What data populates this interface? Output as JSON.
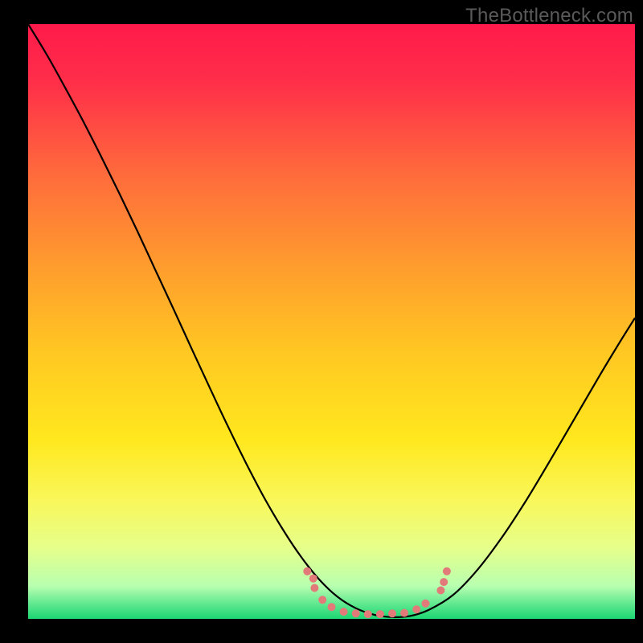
{
  "watermark": "TheBottleneck.com",
  "chart_data": {
    "type": "line",
    "title": "",
    "xlabel": "",
    "ylabel": "",
    "xlim": [
      0,
      100
    ],
    "ylim": [
      0,
      100
    ],
    "background_gradient": {
      "stops": [
        {
          "pos": 0.0,
          "color": "#ff1a4b"
        },
        {
          "pos": 0.1,
          "color": "#ff2f49"
        },
        {
          "pos": 0.25,
          "color": "#ff6a3c"
        },
        {
          "pos": 0.4,
          "color": "#ff9a2e"
        },
        {
          "pos": 0.55,
          "color": "#ffc722"
        },
        {
          "pos": 0.7,
          "color": "#ffe81e"
        },
        {
          "pos": 0.8,
          "color": "#f9f75a"
        },
        {
          "pos": 0.88,
          "color": "#e6ff8a"
        },
        {
          "pos": 0.945,
          "color": "#b8ffb0"
        },
        {
          "pos": 0.975,
          "color": "#5fe88f"
        },
        {
          "pos": 1.0,
          "color": "#1cd672"
        }
      ]
    },
    "series": [
      {
        "name": "bottleneck-curve",
        "color": "#000000",
        "x": [
          0.0,
          3.0,
          6.0,
          9.0,
          12.0,
          15.0,
          18.0,
          21.0,
          24.0,
          27.0,
          30.0,
          33.0,
          36.0,
          39.0,
          42.0,
          45.0,
          48.0,
          51.0,
          54.0,
          57.0,
          60.0,
          63.0,
          66.0,
          70.0,
          74.0,
          78.0,
          82.0,
          86.0,
          90.0,
          94.0,
          97.0,
          100.0
        ],
        "values": [
          100.0,
          95.0,
          89.5,
          83.8,
          77.8,
          71.6,
          65.2,
          58.6,
          52.0,
          45.3,
          38.7,
          32.2,
          26.0,
          20.2,
          15.0,
          10.4,
          6.6,
          3.7,
          1.8,
          0.7,
          0.3,
          0.5,
          1.5,
          4.0,
          8.2,
          13.6,
          19.8,
          26.6,
          33.6,
          40.6,
          45.7,
          50.6
        ]
      }
    ],
    "markers": [
      {
        "x": 46.0,
        "y": 8.0,
        "r": 5,
        "color": "#e27a7a"
      },
      {
        "x": 47.0,
        "y": 6.8,
        "r": 5,
        "color": "#e27a7a"
      },
      {
        "x": 47.2,
        "y": 5.2,
        "r": 5,
        "color": "#e27a7a"
      },
      {
        "x": 48.5,
        "y": 3.2,
        "r": 5,
        "color": "#e27a7a"
      },
      {
        "x": 50.0,
        "y": 2.0,
        "r": 5,
        "color": "#e27a7a"
      },
      {
        "x": 52.0,
        "y": 1.2,
        "r": 5,
        "color": "#e27a7a"
      },
      {
        "x": 54.0,
        "y": 0.9,
        "r": 5,
        "color": "#e27a7a"
      },
      {
        "x": 56.0,
        "y": 0.8,
        "r": 5,
        "color": "#e27a7a"
      },
      {
        "x": 58.0,
        "y": 0.8,
        "r": 5,
        "color": "#e27a7a"
      },
      {
        "x": 60.0,
        "y": 0.9,
        "r": 5,
        "color": "#e27a7a"
      },
      {
        "x": 62.0,
        "y": 1.0,
        "r": 5,
        "color": "#e27a7a"
      },
      {
        "x": 64.0,
        "y": 1.6,
        "r": 5,
        "color": "#e27a7a"
      },
      {
        "x": 65.5,
        "y": 2.6,
        "r": 5,
        "color": "#e27a7a"
      },
      {
        "x": 68.0,
        "y": 4.8,
        "r": 5,
        "color": "#e27a7a"
      },
      {
        "x": 68.5,
        "y": 6.2,
        "r": 5,
        "color": "#e27a7a"
      },
      {
        "x": 69.0,
        "y": 8.0,
        "r": 5,
        "color": "#e27a7a"
      }
    ]
  }
}
